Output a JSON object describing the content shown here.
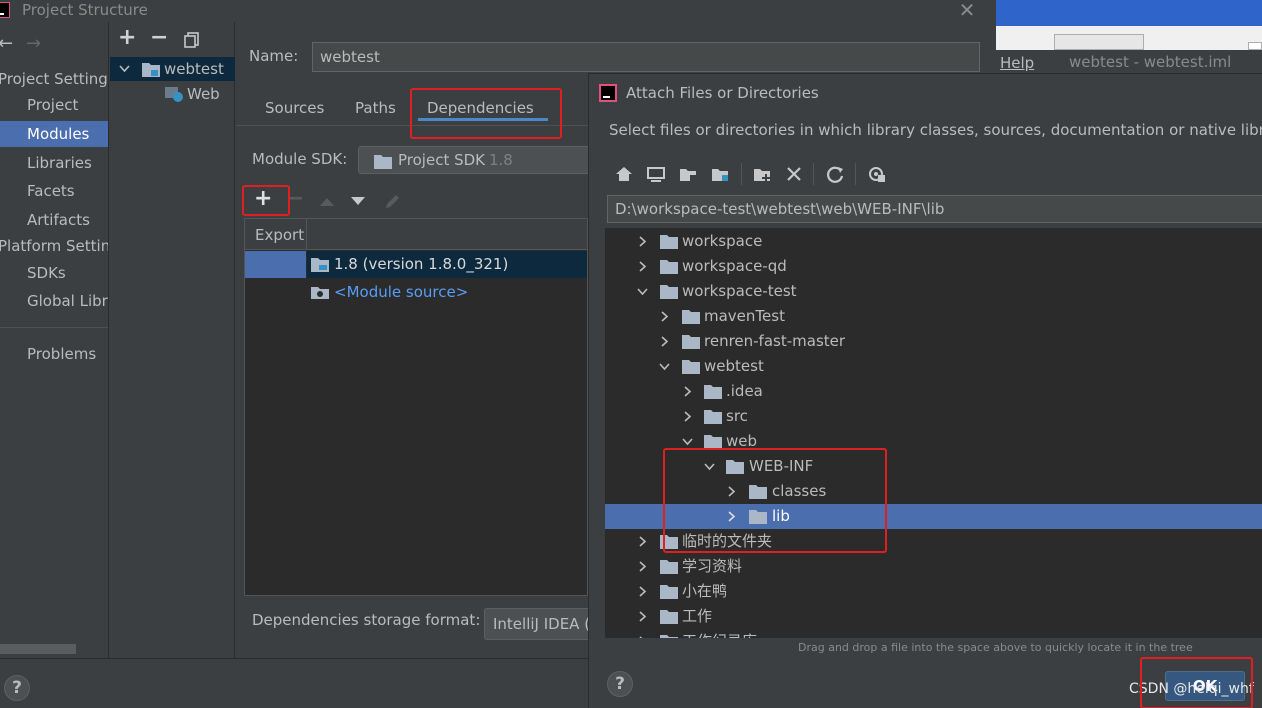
{
  "window": {
    "title": "Project Structure",
    "close_glyph": "✕"
  },
  "nav": {
    "back_glyph": "←",
    "forward_glyph": "→",
    "project_settings_header": "Project Settings",
    "platform_settings_header": "Platform Settings",
    "items": [
      {
        "label": "Project"
      },
      {
        "label": "Modules"
      },
      {
        "label": "Libraries"
      },
      {
        "label": "Facets"
      },
      {
        "label": "Artifacts"
      },
      {
        "label": "SDKs"
      },
      {
        "label": "Global Libraries"
      },
      {
        "label": "Problems"
      }
    ]
  },
  "module_tree": {
    "add_glyph": "+",
    "remove_glyph": "−",
    "items": [
      {
        "label": "webtest"
      },
      {
        "label": "Web"
      }
    ]
  },
  "module": {
    "name_label": "Name:",
    "name_value": "webtest",
    "tabs": [
      {
        "label": "Sources"
      },
      {
        "label": "Paths"
      },
      {
        "label": "Dependencies"
      }
    ],
    "sdk_label": "Module SDK:",
    "sdk_value": "Project SDK",
    "sdk_version": "1.8",
    "add_glyph": "+",
    "remove_glyph": "−",
    "table_header_export": "Export",
    "dependencies": [
      {
        "label": "1.8 (version 1.8.0_321)"
      },
      {
        "label": "<Module source>"
      }
    ],
    "storage_format_label": "Dependencies storage format:",
    "storage_format_value": "IntelliJ IDEA (."
  },
  "background_app": {
    "menu_help": "Help",
    "title": "webtest - webtest.iml"
  },
  "dialog": {
    "title": "Attach Files or Directories",
    "description": "Select files or directories in which library classes, sources, documentation or native libraries are located",
    "path_value": "D:\\workspace-test\\webtest\\web\\WEB-INF\\lib",
    "tree": [
      {
        "label": "workspace"
      },
      {
        "label": "workspace-qd"
      },
      {
        "label": "workspace-test"
      },
      {
        "label": "mavenTest"
      },
      {
        "label": "renren-fast-master"
      },
      {
        "label": "webtest"
      },
      {
        "label": ".idea"
      },
      {
        "label": "src"
      },
      {
        "label": "web"
      },
      {
        "label": "WEB-INF"
      },
      {
        "label": "classes"
      },
      {
        "label": "lib"
      },
      {
        "label": "临时的文件夹"
      },
      {
        "label": "学习资料"
      },
      {
        "label": "小在鸭"
      },
      {
        "label": "工作"
      },
      {
        "label": "工作纪录库"
      }
    ],
    "drag_hint": "Drag and drop a file into the space above to quickly locate it in the tree",
    "ok_label": "OK",
    "help_glyph": "?"
  },
  "footer": {
    "help_glyph": "?"
  },
  "watermark": "CSDN @helqi_whf",
  "colors": {
    "accent": "#4b6eaf",
    "highlight_box": "#e02020",
    "link": "#589df6"
  }
}
